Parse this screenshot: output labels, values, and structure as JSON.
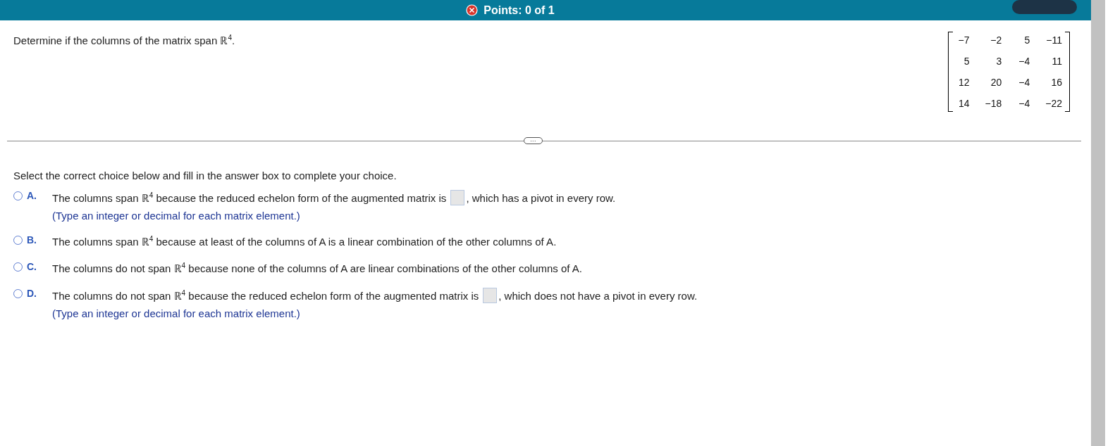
{
  "header": {
    "points": "Points: 0 of 1",
    "incorrect": true
  },
  "question": {
    "text": "Determine if the columns of the matrix span ℝ$^{4}$.",
    "matrix": [
      [
        "−7",
        "−2",
        "5",
        "−11"
      ],
      [
        "5",
        "3",
        "−4",
        "11"
      ],
      [
        "12",
        "20",
        "−4",
        "16"
      ],
      [
        "14",
        "−18",
        "−4",
        "−22"
      ]
    ]
  },
  "divider": {
    "label": "···"
  },
  "instruction": "Select the correct choice below and fill in the answer box to complete your choice.",
  "choices": [
    {
      "letter": "A.",
      "selected": false,
      "segments": [
        {
          "kind": "text",
          "text": "The columns span ℝ$^{4}$ because the reduced echelon form of the augmented matrix is"
        },
        {
          "kind": "box"
        },
        {
          "kind": "text",
          "text": ", which has a pivot in every row."
        }
      ],
      "hint": "(Type an integer or decimal for each matrix element.)"
    },
    {
      "letter": "B.",
      "selected": false,
      "segments": [
        {
          "kind": "text",
          "text": "The columns span ℝ$^{4}$ because at least of the columns of A is a linear combination of the other columns of A."
        }
      ]
    },
    {
      "letter": "C.",
      "selected": false,
      "segments": [
        {
          "kind": "text",
          "text": "The columns do not span ℝ$^{4}$ because none of the columns of A are linear combinations of the other columns of A."
        }
      ]
    },
    {
      "letter": "D.",
      "selected": false,
      "segments": [
        {
          "kind": "text",
          "text": "The columns do not span ℝ$^{4}$ because the reduced echelon form of the augmented matrix is"
        },
        {
          "kind": "box"
        },
        {
          "kind": "text",
          "text": ", which does not have a pivot in every row."
        }
      ],
      "hint": "(Type an integer or decimal for each matrix element.)"
    }
  ]
}
